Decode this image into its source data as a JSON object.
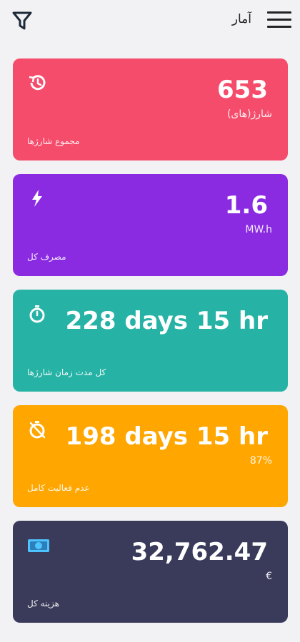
{
  "header": {
    "title": "آمار"
  },
  "cards": [
    {
      "value": "653",
      "unit": "شارژ(های)",
      "label": "مجموع  شارژها",
      "color": "#f64c6b",
      "icon": "history-icon"
    },
    {
      "value": "1.6",
      "unit": "MW.h",
      "label": "مصرف کل",
      "color": "#8a2be2",
      "icon": "lightning-icon"
    },
    {
      "value": "228 days 15 hr",
      "unit": "",
      "label": "کل مدت زمان  شارژها",
      "color": "#26b3a5",
      "icon": "stopwatch-icon"
    },
    {
      "value": "198 days 15 hr",
      "unit": "87%",
      "label": "عدم فعالیت کامل",
      "color": "#ffa600",
      "icon": "stopwatch-off-icon"
    },
    {
      "value": "32,762.47",
      "unit": "€",
      "label": "هزینه کل",
      "color": "#3a3a5a",
      "icon": "money-icon"
    }
  ]
}
